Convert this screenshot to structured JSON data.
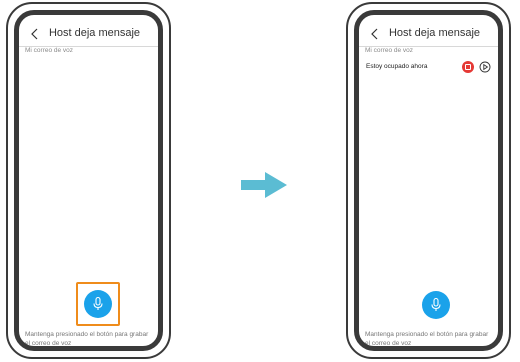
{
  "left_screen": {
    "title": "Host deja mensaje",
    "subtitle": "Mi correo de voz",
    "hint": "Mantenga presionado el botón para grabar el correo de voz"
  },
  "right_screen": {
    "title": "Host deja mensaje",
    "subtitle": "Mi correo de voz",
    "message_label": "Estoy ocupado ahora",
    "hint": "Mantenga presionado el botón para grabar el correo de voz"
  },
  "colors": {
    "accent": "#1aa2ea",
    "highlight": "#ef8c1b",
    "stop": "#e53935",
    "arrow": "#5bbcd3"
  }
}
